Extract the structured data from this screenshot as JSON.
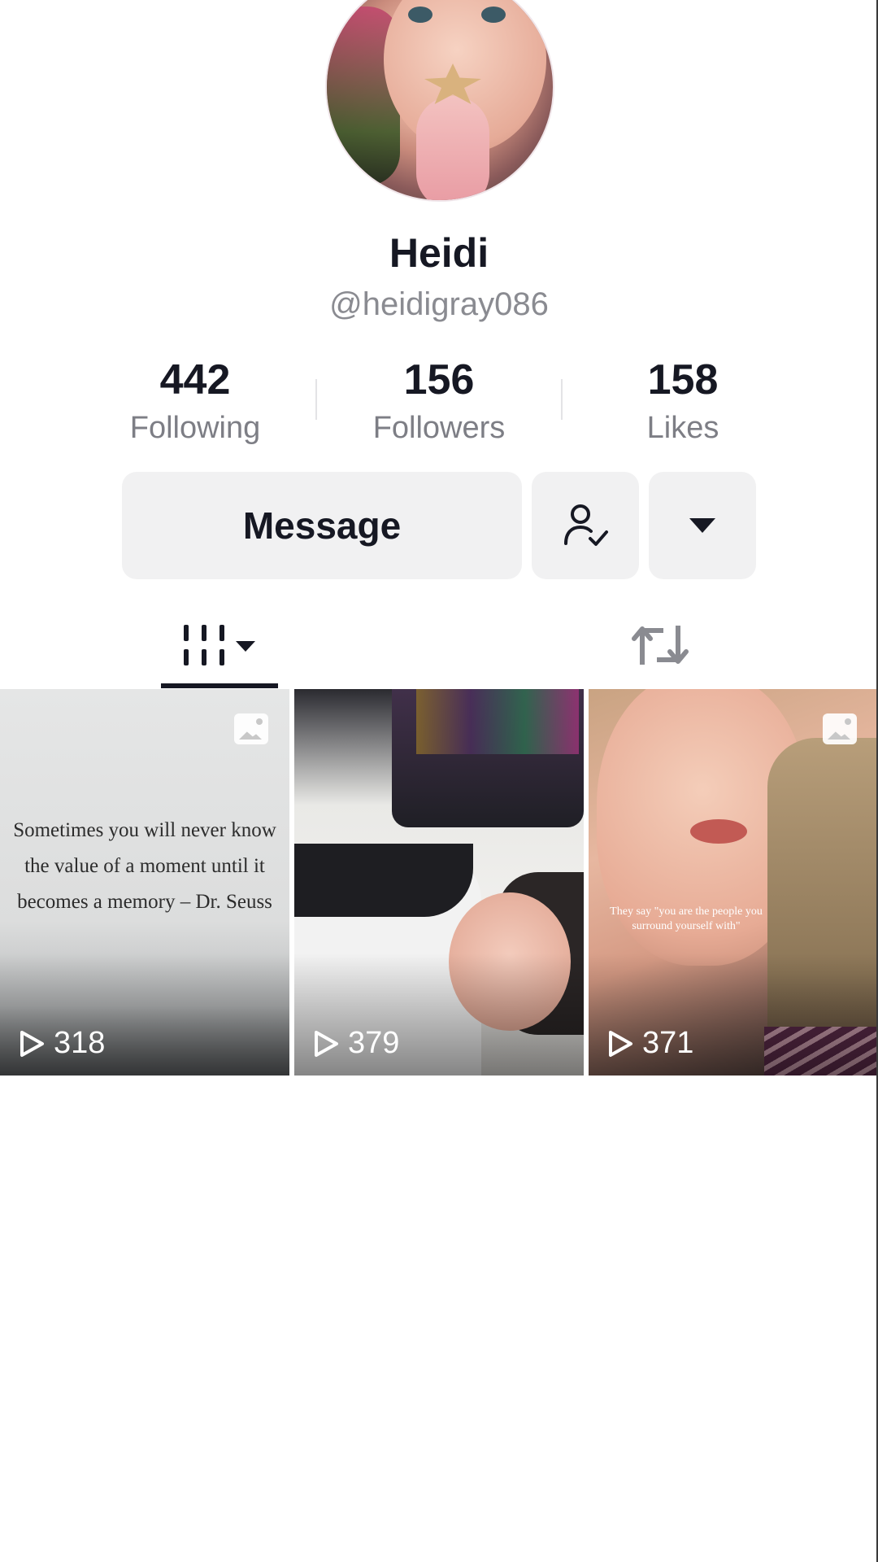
{
  "profile": {
    "display_name": "Heidi",
    "username": "@heidigray086",
    "avatar_icon": "avatar-photo"
  },
  "stats": [
    {
      "value": "442",
      "label": "Following"
    },
    {
      "value": "156",
      "label": "Followers"
    },
    {
      "value": "158",
      "label": "Likes"
    }
  ],
  "actions": {
    "message_label": "Message",
    "following_icon": "user-check-icon",
    "more_icon": "caret-down-icon"
  },
  "tabs": {
    "videos_icon": "grid-icon",
    "reposts_icon": "repost-icon",
    "active": "videos"
  },
  "videos": [
    {
      "views": "318",
      "type": "photo",
      "overlay_text": "Sometimes you will never know the value of a moment until it becomes a memory – Dr. Seuss"
    },
    {
      "views": "379",
      "type": "video",
      "overlay_text": ""
    },
    {
      "views": "371",
      "type": "photo",
      "overlay_text": "They say \"you are the people you surround yourself with\""
    }
  ],
  "colors": {
    "text_primary": "#161823",
    "text_secondary": "#8a8b91",
    "button_bg": "#f1f1f2"
  }
}
